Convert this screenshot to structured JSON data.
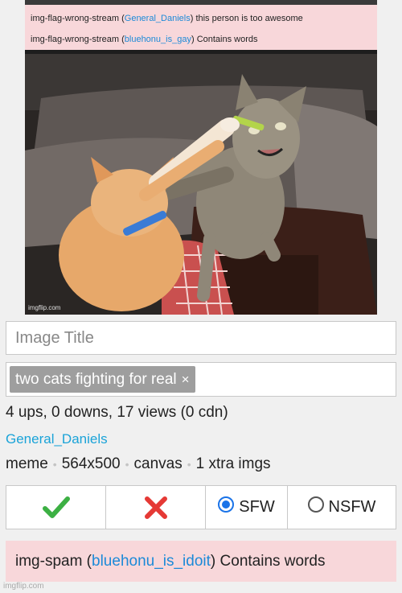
{
  "flags": [
    {
      "reason": "img-flag-wrong-stream",
      "user": "General_Daniels",
      "comment": "this person is too awesome"
    },
    {
      "reason": "img-flag-wrong-stream",
      "user": "bluehonu_is_gay",
      "comment": "Contains words"
    }
  ],
  "photo": {
    "watermark": "imgflip.com"
  },
  "title_input": {
    "placeholder": "Image Title",
    "value": ""
  },
  "tags": [
    {
      "label": "two cats fighting for real",
      "remove": "×"
    }
  ],
  "stats": {
    "text": "4 ups, 0 downs, 17 views (0 cdn)"
  },
  "author": {
    "name": "General_Daniels"
  },
  "meta": {
    "type": "meme",
    "size": "564x500",
    "mode": "canvas",
    "extra": "1 xtra imgs"
  },
  "actions": {
    "approve_icon": "check-icon",
    "reject_icon": "x-icon",
    "sfw_label": "SFW",
    "nsfw_label": "NSFW",
    "selected": "SFW"
  },
  "spam_flag": {
    "reason": "img-spam",
    "user": "bluehonu_is_idoit",
    "comment": "Contains words"
  },
  "footer": {
    "watermark": "imgflip.com"
  },
  "colors": {
    "flag_bg": "#f8d7da",
    "link": "#1c8ad8",
    "approve": "#3cb043",
    "reject": "#e53935"
  }
}
